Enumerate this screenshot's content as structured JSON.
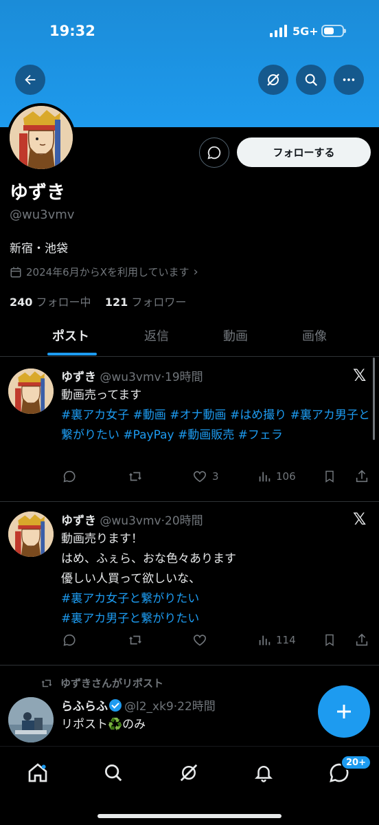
{
  "status_bar": {
    "time": "19:32",
    "network": "5G+"
  },
  "profile": {
    "name": "ゆずき",
    "handle": "@wu3vmv",
    "bio": "新宿・池袋",
    "joined": "2024年6月からXを利用しています",
    "following_count": "240",
    "following_label": "フォロー中",
    "followers_count": "121",
    "followers_label": "フォロワー",
    "follow_button": "フォローする"
  },
  "tabs": [
    "ポスト",
    "返信",
    "動画",
    "画像"
  ],
  "posts": [
    {
      "name": "ゆずき",
      "handle": "@wu3vmv",
      "time": "19時間",
      "text": "動画売ってます",
      "tags": "#裏アカ女子 #動画 #オナ動画 #はめ撮り #裏アカ男子と繋がりたい #PayPay #動画販売 #フェラ",
      "likes": "3",
      "views": "106"
    },
    {
      "name": "ゆずき",
      "handle": "@wu3vmv",
      "time": "20時間",
      "line1": "動画売ります！",
      "line2": "はめ、ふぇら、おな色々あります",
      "line3": "優しい人買って欲しいな、",
      "tag1": "#裏アカ女子と繋がりたい",
      "tag2": "#裏アカ男子と繋がりたい",
      "views": "114"
    },
    {
      "repost_label": "ゆずきさんがリポスト",
      "name": "らふらふ",
      "handle": "@l2_xk9",
      "time": "22時間",
      "text_before": "リポスト",
      "recycle": "♻️",
      "text_after": "のみ"
    }
  ],
  "nav": {
    "badge": "20+"
  },
  "colors": {
    "accent": "#1d9bf0",
    "banner": "#1e9aed",
    "muted": "#71767b"
  }
}
